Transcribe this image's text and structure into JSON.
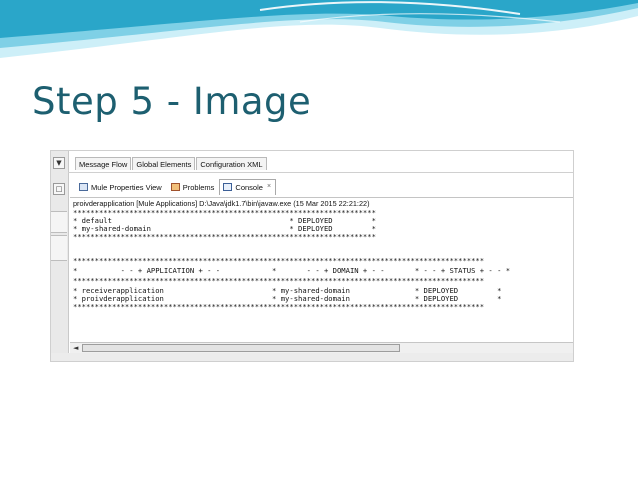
{
  "slide": {
    "title": "Step 5 - Image",
    "colors": {
      "title": "#1d5f70",
      "wave_dark": "#2aa6c9",
      "wave_light": "#cdeff8"
    }
  },
  "editor_tabs": [
    "Message Flow",
    "Global Elements",
    "Configuration XML"
  ],
  "view_tabs": [
    {
      "label": "Mule Properties View",
      "icon": "properties-icon"
    },
    {
      "label": "Problems",
      "icon": "problems-icon"
    },
    {
      "label": "Console",
      "icon": "console-icon",
      "active": true,
      "close": "×"
    }
  ],
  "left_strip": {
    "dropdown_glyph": "▼",
    "box_glyph": "□"
  },
  "console": {
    "header": "proivderapplication [Mule Applications] D:\\Java\\jdk1.7\\bin\\javaw.exe (15 Mar 2015 22:21:22)",
    "lines": [
      "**********************************************************************",
      "* default                                         * DEPLOYED         *",
      "* my-shared-domain                                * DEPLOYED         *",
      "**********************************************************************",
      "",
      "***********************************************************************************************",
      "*          - - + APPLICATION + - -            *       - - + DOMAIN + - -       * - - + STATUS + - - *",
      "***********************************************************************************************",
      "* receiverapplication                         * my-shared-domain               * DEPLOYED         *",
      "* proivderapplication                         * my-shared-domain               * DEPLOYED         *",
      "***********************************************************************************************"
    ]
  },
  "scrollbar": {
    "arrow_glyph": "◄"
  }
}
